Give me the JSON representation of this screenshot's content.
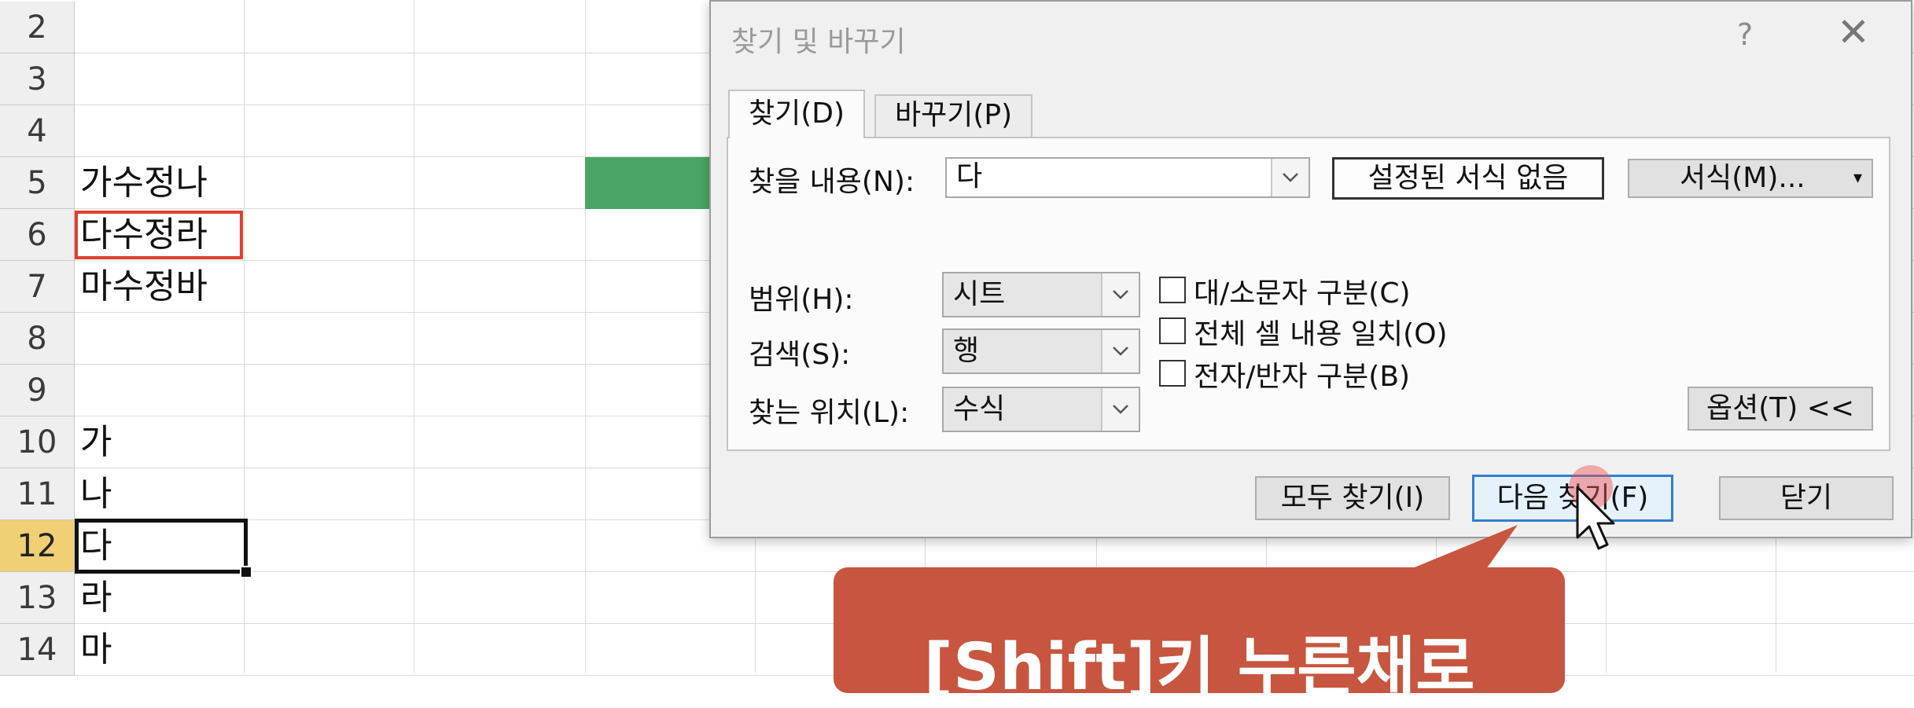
{
  "sheet": {
    "rows": [
      {
        "num": "2",
        "a": ""
      },
      {
        "num": "3",
        "a": ""
      },
      {
        "num": "4",
        "a": ""
      },
      {
        "num": "5",
        "a": "가수정나"
      },
      {
        "num": "6",
        "a": "다수정라"
      },
      {
        "num": "7",
        "a": "마수정바"
      },
      {
        "num": "8",
        "a": ""
      },
      {
        "num": "9",
        "a": ""
      },
      {
        "num": "10",
        "a": "가"
      },
      {
        "num": "11",
        "a": "나"
      },
      {
        "num": "12",
        "a": "다"
      },
      {
        "num": "13",
        "a": "라"
      },
      {
        "num": "14",
        "a": "마"
      }
    ]
  },
  "dialog": {
    "title": "찾기 및 바꾸기",
    "help": "?",
    "tabs": {
      "find": "찾기(D)",
      "replace": "바꾸기(P)"
    },
    "find_what_label": "찾을 내용(N):",
    "find_what_value": "다",
    "no_format_label": "설정된 서식 없음",
    "format_button": "서식(M)...",
    "within_label": "범위(H):",
    "within_value": "시트",
    "search_label": "검색(S):",
    "search_value": "행",
    "look_in_label": "찾는 위치(L):",
    "look_in_value": "수식",
    "match_case": "대/소문자 구분(C)",
    "match_entire": "전체 셀 내용 일치(O)",
    "match_byte": "전자/반자 구분(B)",
    "options_button": "옵션(T) <<",
    "find_all_button": "모두 찾기(I)",
    "find_next_button": "다음 찾기(F)",
    "close_button": "닫기"
  },
  "callout": {
    "text": "[Shift]키 누른채로"
  },
  "colors": {
    "accent_green": "#4aa564",
    "callout": "#c8553f",
    "highlight_red": "#e0412c",
    "active_row_header": "#f0cf75"
  }
}
